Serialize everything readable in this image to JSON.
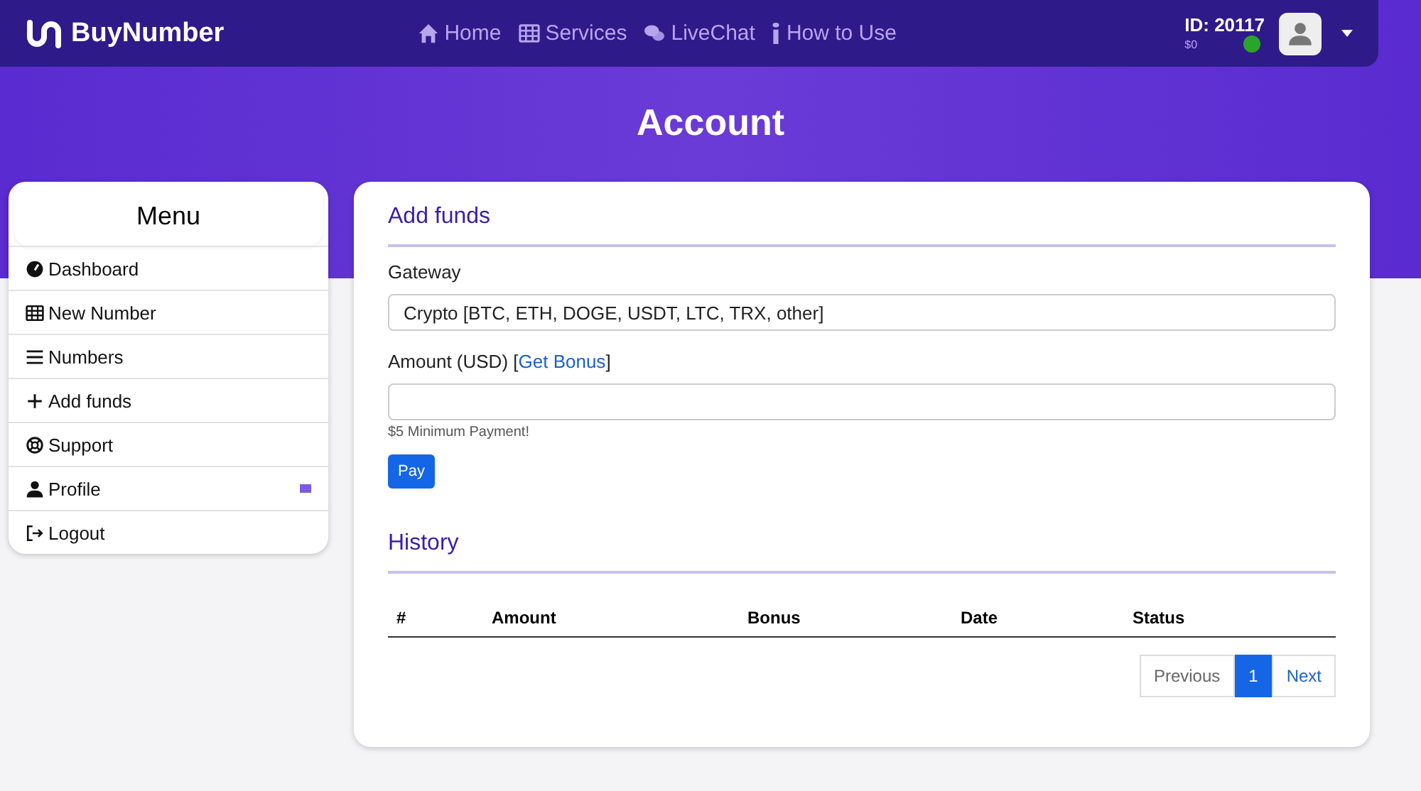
{
  "brand": {
    "name": "BuyNumber"
  },
  "nav": [
    {
      "label": "Home"
    },
    {
      "label": "Services"
    },
    {
      "label": "LiveChat"
    },
    {
      "label": "How to Use"
    }
  ],
  "account": {
    "id": "ID: 20117",
    "balance": "$0"
  },
  "page_title": "Account",
  "menu": {
    "title": "Menu",
    "items": [
      {
        "label": "Dashboard",
        "badge": false
      },
      {
        "label": "New Number",
        "badge": false
      },
      {
        "label": "Numbers",
        "badge": false
      },
      {
        "label": "Add funds",
        "badge": false
      },
      {
        "label": "Support",
        "badge": false
      },
      {
        "label": "Profile",
        "badge": true
      },
      {
        "label": "Logout",
        "badge": false
      }
    ]
  },
  "add_funds": {
    "title": "Add funds",
    "gateway_label": "Gateway",
    "gateway_value": "Crypto [BTC, ETH, DOGE, USDT, LTC, TRX, other]",
    "amount_label": "Amount (USD) [",
    "bonus_link": "Get Bonus",
    "amount_label_end": "]",
    "hint": "$5 Minimum Payment!",
    "button": "Pay"
  },
  "history": {
    "title": "History",
    "columns": [
      "#",
      "Amount",
      "Bonus",
      "Date",
      "Status"
    ],
    "pagination": [
      {
        "label": "Previous",
        "selected": false
      },
      {
        "label": "1",
        "selected": true
      },
      {
        "label": "Next",
        "selected": false
      }
    ]
  }
}
